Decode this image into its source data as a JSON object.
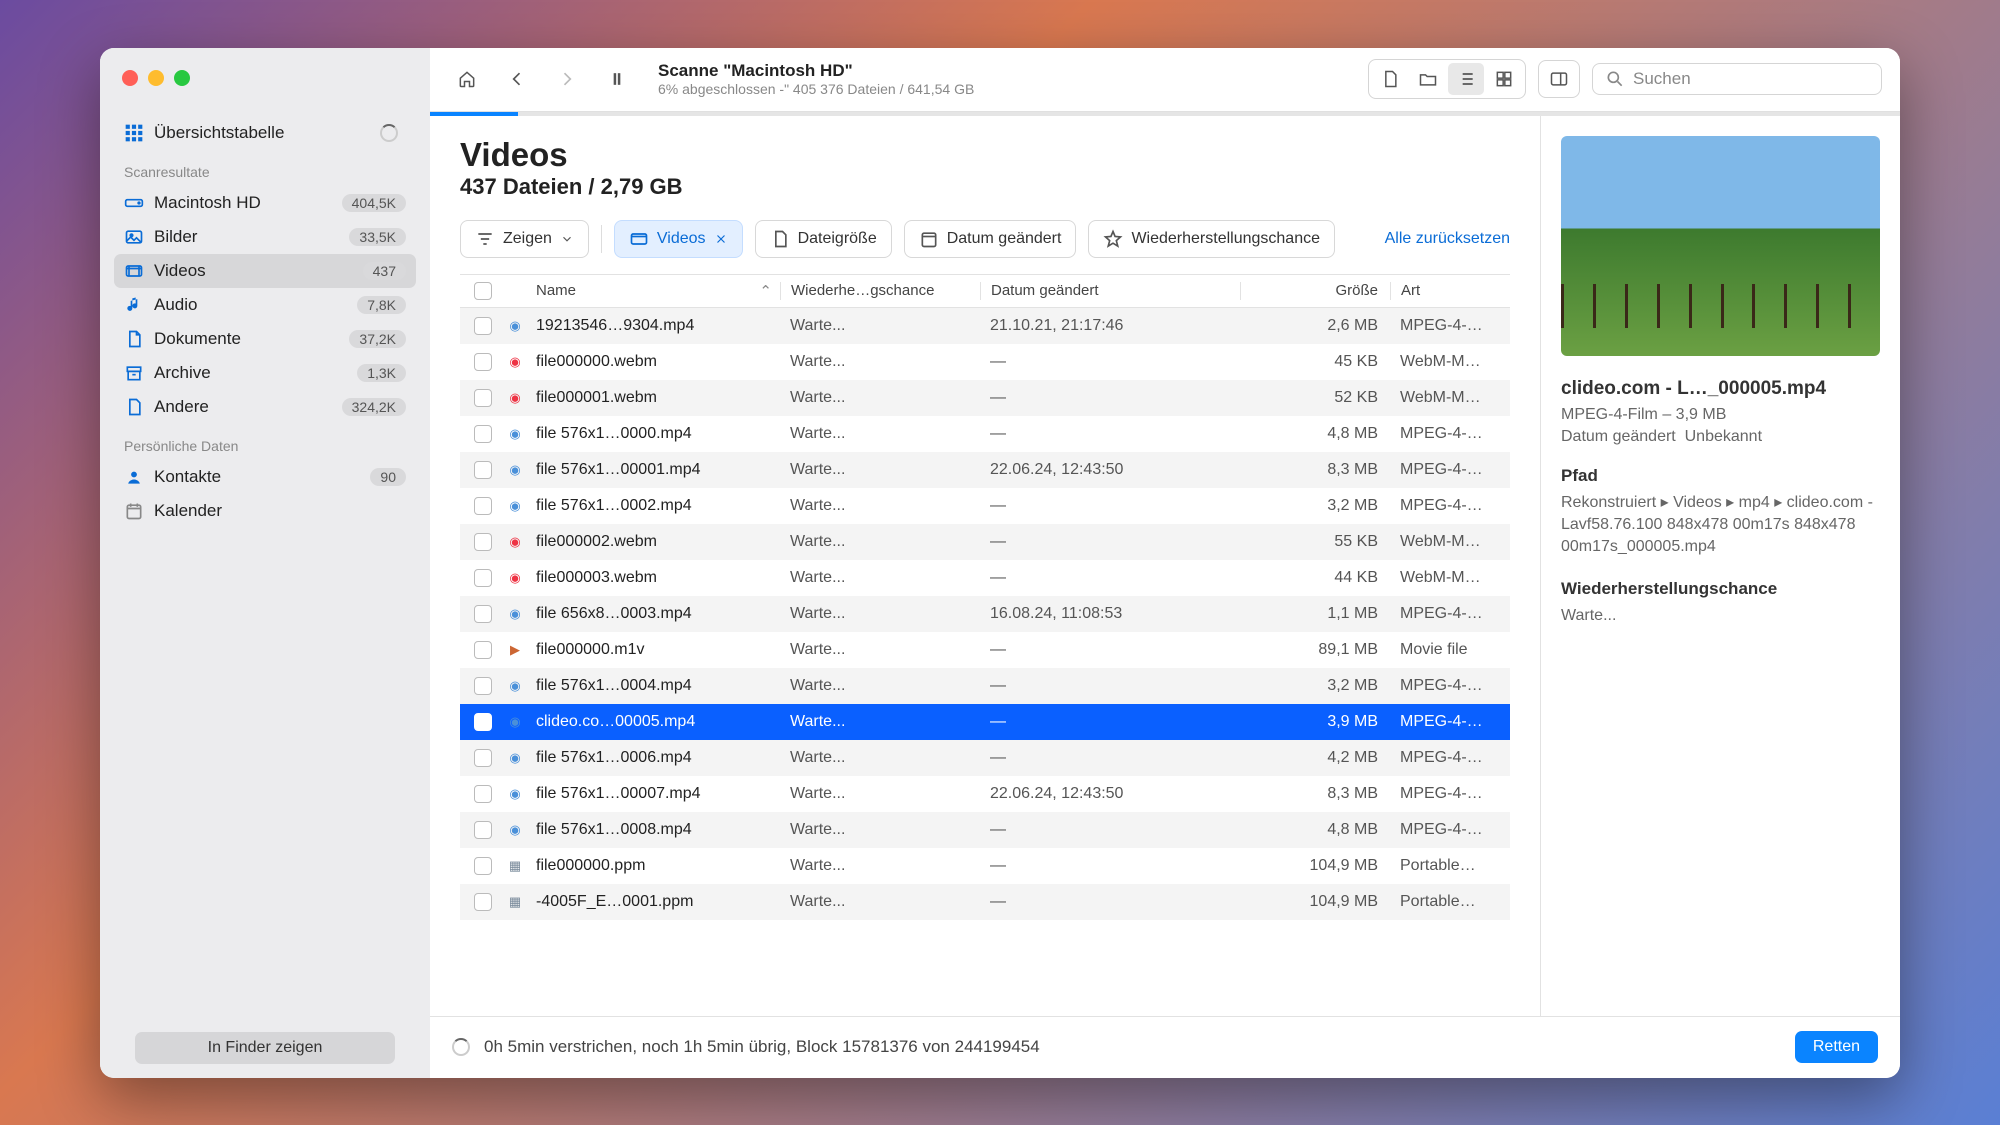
{
  "toolbar": {
    "title": "Scanne \"Macintosh HD\"",
    "subtitle": "6% abgeschlossen -\" 405 376 Dateien / 641,54 GB",
    "search_placeholder": "Suchen",
    "progress_pct": 6
  },
  "sidebar": {
    "overview": "Übersichtstabelle",
    "heads": {
      "results": "Scanresultate",
      "personal": "Persönliche Daten"
    },
    "items": {
      "mac": {
        "label": "Macintosh HD",
        "count": "404,5K"
      },
      "bilder": {
        "label": "Bilder",
        "count": "33,5K"
      },
      "videos": {
        "label": "Videos",
        "count": "437"
      },
      "audio": {
        "label": "Audio",
        "count": "7,8K"
      },
      "dokumente": {
        "label": "Dokumente",
        "count": "37,2K"
      },
      "archive": {
        "label": "Archive",
        "count": "1,3K"
      },
      "andere": {
        "label": "Andere",
        "count": "324,2K"
      },
      "kontakte": {
        "label": "Kontakte",
        "count": "90"
      },
      "kalender": {
        "label": "Kalender"
      }
    },
    "finder_btn": "In Finder zeigen"
  },
  "header": {
    "title": "Videos",
    "subtitle": "437 Dateien / 2,79 GB"
  },
  "filters": {
    "show": "Zeigen",
    "videos": "Videos",
    "size": "Dateigröße",
    "date": "Datum geändert",
    "chance": "Wiederherstellungschance",
    "reset": "Alle zurücksetzen"
  },
  "cols": {
    "name": "Name",
    "chance": "Wiederhe…gschance",
    "date": "Datum geändert",
    "size": "Größe",
    "art": "Art"
  },
  "rows": [
    {
      "name": "19213546…9304.mp4",
      "chance": "Warte...",
      "date": "21.10.21, 21:17:46",
      "size": "2,6 MB",
      "art": "MPEG-4-…",
      "k": 1
    },
    {
      "name": "file000000.webm",
      "chance": "Warte...",
      "date": "—",
      "size": "45 KB",
      "art": "WebM-M…",
      "k": 2
    },
    {
      "name": "file000001.webm",
      "chance": "Warte...",
      "date": "—",
      "size": "52 KB",
      "art": "WebM-M…",
      "k": 2
    },
    {
      "name": "file 576x1…0000.mp4",
      "chance": "Warte...",
      "date": "—",
      "size": "4,8 MB",
      "art": "MPEG-4-…",
      "k": 1
    },
    {
      "name": "file 576x1…00001.mp4",
      "chance": "Warte...",
      "date": "22.06.24, 12:43:50",
      "size": "8,3 MB",
      "art": "MPEG-4-…",
      "k": 1
    },
    {
      "name": "file 576x1…0002.mp4",
      "chance": "Warte...",
      "date": "—",
      "size": "3,2 MB",
      "art": "MPEG-4-…",
      "k": 1
    },
    {
      "name": "file000002.webm",
      "chance": "Warte...",
      "date": "—",
      "size": "55 KB",
      "art": "WebM-M…",
      "k": 2
    },
    {
      "name": "file000003.webm",
      "chance": "Warte...",
      "date": "—",
      "size": "44 KB",
      "art": "WebM-M…",
      "k": 2
    },
    {
      "name": "file 656x8…0003.mp4",
      "chance": "Warte...",
      "date": "16.08.24, 11:08:53",
      "size": "1,1 MB",
      "art": "MPEG-4-…",
      "k": 1
    },
    {
      "name": "file000000.m1v",
      "chance": "Warte...",
      "date": "—",
      "size": "89,1 MB",
      "art": "Movie file",
      "k": 3
    },
    {
      "name": "file 576x1…0004.mp4",
      "chance": "Warte...",
      "date": "—",
      "size": "3,2 MB",
      "art": "MPEG-4-…",
      "k": 1
    },
    {
      "name": "clideo.co…00005.mp4",
      "chance": "Warte...",
      "date": "—",
      "size": "3,9 MB",
      "art": "MPEG-4-…",
      "k": 1,
      "sel": true
    },
    {
      "name": "file 576x1…0006.mp4",
      "chance": "Warte...",
      "date": "—",
      "size": "4,2 MB",
      "art": "MPEG-4-…",
      "k": 1
    },
    {
      "name": "file 576x1…00007.mp4",
      "chance": "Warte...",
      "date": "22.06.24, 12:43:50",
      "size": "8,3 MB",
      "art": "MPEG-4-…",
      "k": 1
    },
    {
      "name": "file 576x1…0008.mp4",
      "chance": "Warte...",
      "date": "—",
      "size": "4,8 MB",
      "art": "MPEG-4-…",
      "k": 1
    },
    {
      "name": "file000000.ppm",
      "chance": "Warte...",
      "date": "—",
      "size": "104,9 MB",
      "art": "Portable…",
      "k": 4
    },
    {
      "name": "-4005F_E…0001.ppm",
      "chance": "Warte...",
      "date": "—",
      "size": "104,9 MB",
      "art": "Portable…",
      "k": 4
    }
  ],
  "inspector": {
    "name": "clideo.com - L…_000005.mp4",
    "sub1": "MPEG-4-Film – 3,9 MB",
    "date_label": "Datum geändert",
    "date_value": "Unbekannt",
    "path_head": "Pfad",
    "path": "Rekonstruiert ▸ Videos ▸ mp4 ▸ clideo.com - Lavf58.76.100 848x478 00m17s 848x478 00m17s_000005.mp4",
    "chance_head": "Wiederherstellungschance",
    "chance": "Warte..."
  },
  "footer": {
    "status": "0h 5min verstrichen, noch 1h 5min übrig, Block 15781376 von 244199454",
    "retten": "Retten"
  }
}
